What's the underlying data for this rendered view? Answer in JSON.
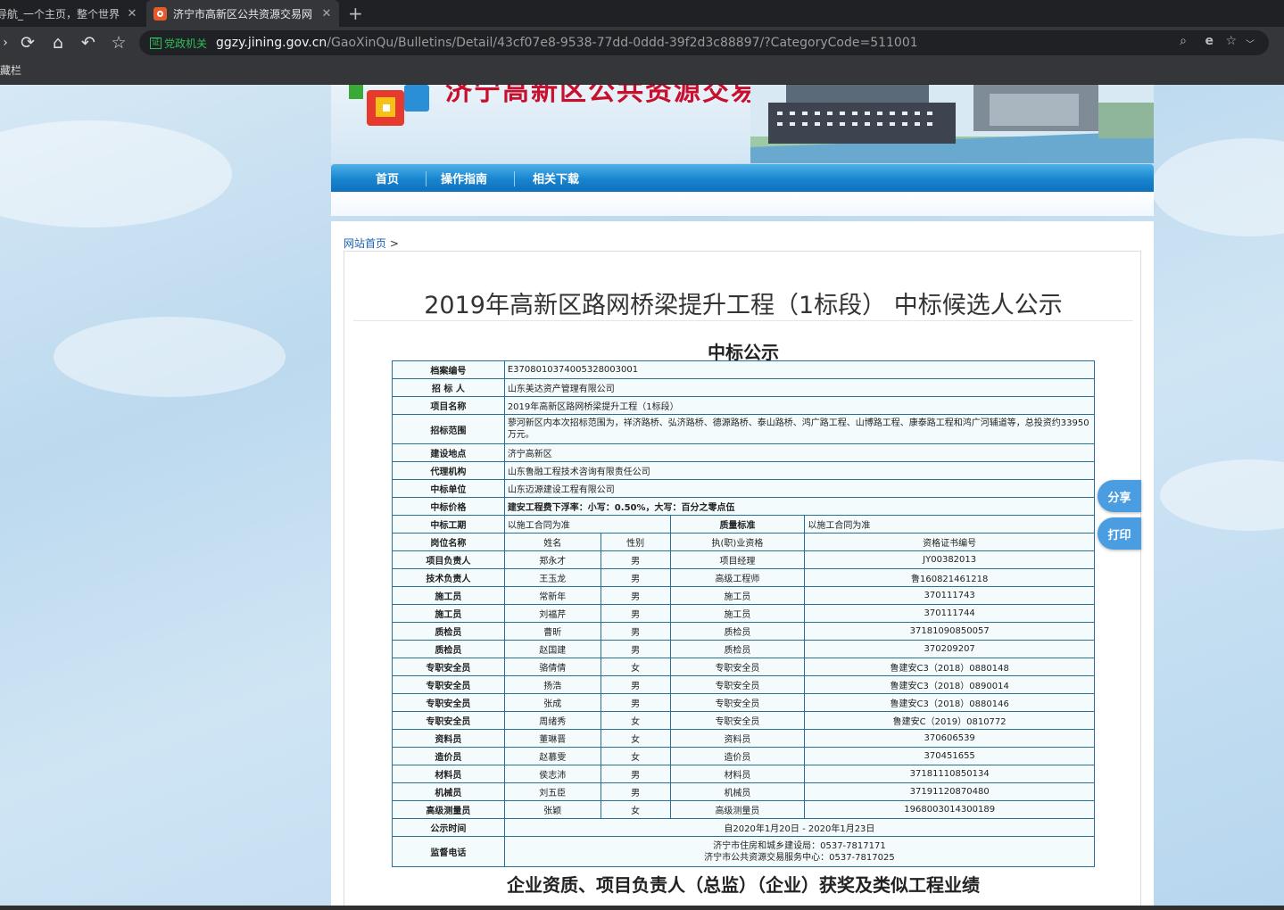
{
  "browser": {
    "tabs": [
      {
        "label": "导航_一个主页，整个世界"
      },
      {
        "label": "济宁市高新区公共资源交易网"
      }
    ],
    "new_tab": "+",
    "gov_badge": "党政机关",
    "gov_badge_icon": "证",
    "url_host": "ggzy.jining.gov.cn",
    "url_path": "/GaoXinQu/Bulletins/Detail/43cf07e8-9538-77dd-0ddd-39f2d3c88897/?CategoryCode=511001",
    "bookmarks_label": "收藏栏",
    "icons": [
      "reload-icon",
      "home-icon",
      "undo-icon",
      "star-icon",
      "zoom-icon",
      "ie-icon",
      "bookmark-star-icon",
      "chevron-down-icon"
    ]
  },
  "site": {
    "banner_title": "济宁高新区公共资源交易",
    "nav": [
      "首页",
      "操作指南",
      "相关下载"
    ],
    "breadcrumb_home": "网站首页",
    "breadcrumb_sep": ">",
    "colors": {
      "nav_blue": "#1784cf",
      "table_border": "#2b6f93",
      "banner_red": "#c8102e"
    }
  },
  "article": {
    "title": "2019年高新区路网桥梁提升工程（1标段） 中标候选人公示",
    "notice_heading": "中标公示",
    "section_heading": "企业资质、项目负责人（总监）（企业）获奖及类似工程业绩"
  },
  "table": {
    "archive_no_label": "档案编号",
    "archive_no": "E3708010374005328003001",
    "tenderer_label": "招 标 人",
    "tenderer": "山东美达资产管理有限公司",
    "project_label": "项目名称",
    "project": "2019年高新区路网桥梁提升工程（1标段）",
    "scope_label": "招标范围",
    "scope": "蓼河新区内本次招标范围为，祥济路桥、弘济路桥、德源路桥、泰山路桥、鸿广路工程、山博路工程、康泰路工程和鸿广河辅道等，总投资约33950万元。",
    "site_label": "建设地点",
    "site": "济宁高新区",
    "agency_label": "代理机构",
    "agency": "山东鲁融工程技术咨询有限责任公司",
    "winner_label": "中标单位",
    "winner": "山东迈源建设工程有限公司",
    "price_label": "中标价格",
    "price": "建安工程费下浮率：小写：0.50%，大写：百分之零点伍",
    "period_label": "中标工期",
    "period": "以施工合同为准",
    "quality_label": "质量标准",
    "quality": "以施工合同为准",
    "headers": [
      "岗位名称",
      "姓名",
      "性别",
      "执(职)业资格",
      "资格证书编号"
    ],
    "staff": [
      {
        "role": "项目负责人",
        "name": "郑永才",
        "sex": "男",
        "qual": "项目经理",
        "cert": "JY00382013"
      },
      {
        "role": "技术负责人",
        "name": "王玉龙",
        "sex": "男",
        "qual": "高级工程师",
        "cert": "鲁160821461218"
      },
      {
        "role": "施工员",
        "name": "常新年",
        "sex": "男",
        "qual": "施工员",
        "cert": "370111743"
      },
      {
        "role": "施工员",
        "name": "刘福芹",
        "sex": "男",
        "qual": "施工员",
        "cert": "370111744"
      },
      {
        "role": "质检员",
        "name": "曹昕",
        "sex": "男",
        "qual": "质检员",
        "cert": "37181090850057"
      },
      {
        "role": "质检员",
        "name": "赵国建",
        "sex": "男",
        "qual": "质检员",
        "cert": "370209207"
      },
      {
        "role": "专职安全员",
        "name": "骆倩倩",
        "sex": "女",
        "qual": "专职安全员",
        "cert": "鲁建安C3（2018）0880148"
      },
      {
        "role": "专职安全员",
        "name": "扬浩",
        "sex": "男",
        "qual": "专职安全员",
        "cert": "鲁建安C3（2018）0890014"
      },
      {
        "role": "专职安全员",
        "name": "张成",
        "sex": "男",
        "qual": "专职安全员",
        "cert": "鲁建安C3（2018）0880146"
      },
      {
        "role": "专职安全员",
        "name": "周绪秀",
        "sex": "女",
        "qual": "专职安全员",
        "cert": "鲁建安C（2019）0810772"
      },
      {
        "role": "资料员",
        "name": "董琳晋",
        "sex": "女",
        "qual": "资料员",
        "cert": "370606539"
      },
      {
        "role": "造价员",
        "name": "赵慕雯",
        "sex": "女",
        "qual": "造价员",
        "cert": "370451655"
      },
      {
        "role": "材料员",
        "name": "侯志沛",
        "sex": "男",
        "qual": "材料员",
        "cert": "37181110850134"
      },
      {
        "role": "机械员",
        "name": "刘五臣",
        "sex": "男",
        "qual": "机械员",
        "cert": "37191120870480"
      },
      {
        "role": "高级测量员",
        "name": "张颖",
        "sex": "女",
        "qual": "高级测量员",
        "cert": "1968003014300189"
      }
    ],
    "publicity_label": "公示时间",
    "publicity": "自2020年1月20日 - 2020年1月23日",
    "supervision_label": "监督电话",
    "supervision_1": "济宁市住房和城乡建设局：0537-7817171",
    "supervision_2": "济宁市公共资源交易服务中心：0537-7817025"
  },
  "side": {
    "share": "分享",
    "print": "打印"
  }
}
